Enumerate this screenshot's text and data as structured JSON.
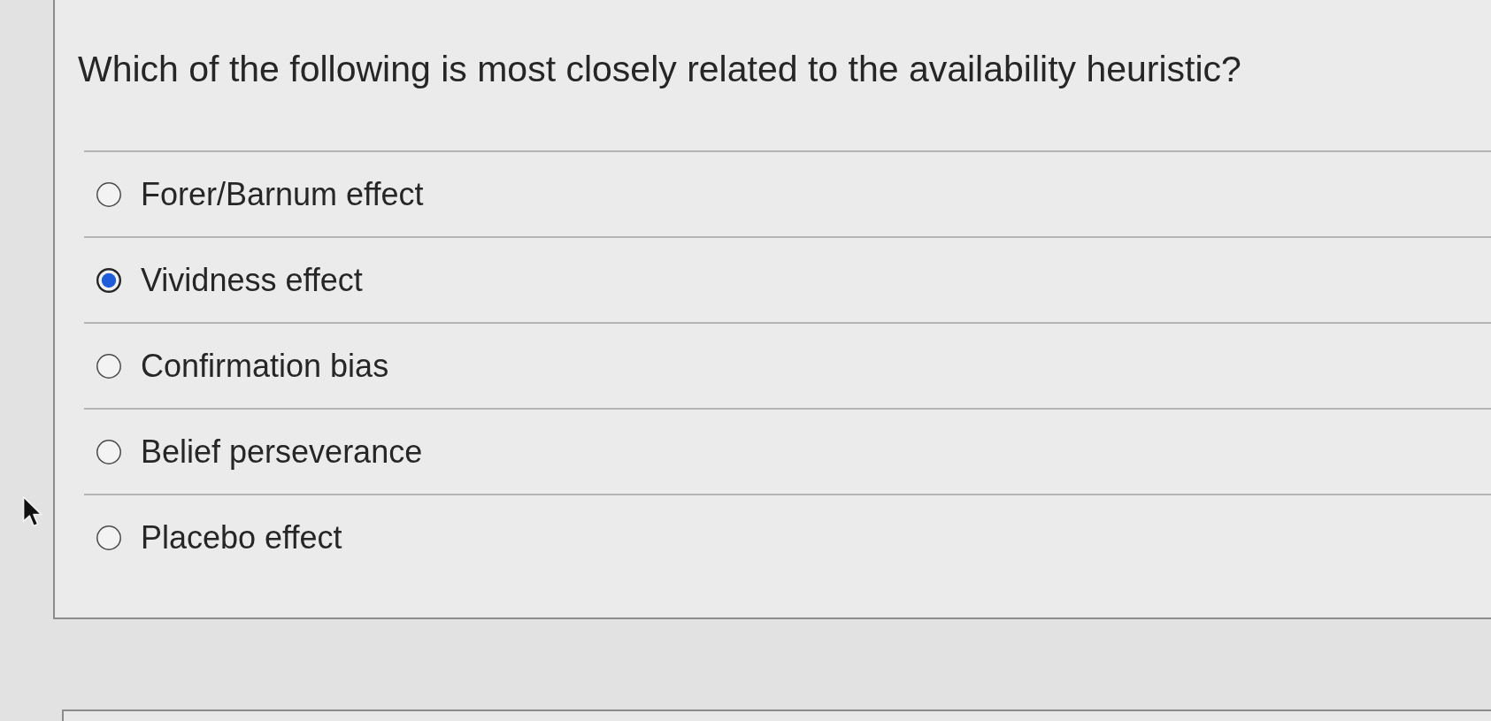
{
  "question": {
    "text": "Which of the following is most closely related to the availability heuristic?"
  },
  "options": [
    {
      "label": "Forer/Barnum effect",
      "selected": false
    },
    {
      "label": "Vividness effect",
      "selected": true
    },
    {
      "label": "Confirmation bias",
      "selected": false
    },
    {
      "label": "Belief perseverance",
      "selected": false
    },
    {
      "label": "Placebo effect",
      "selected": false
    }
  ]
}
